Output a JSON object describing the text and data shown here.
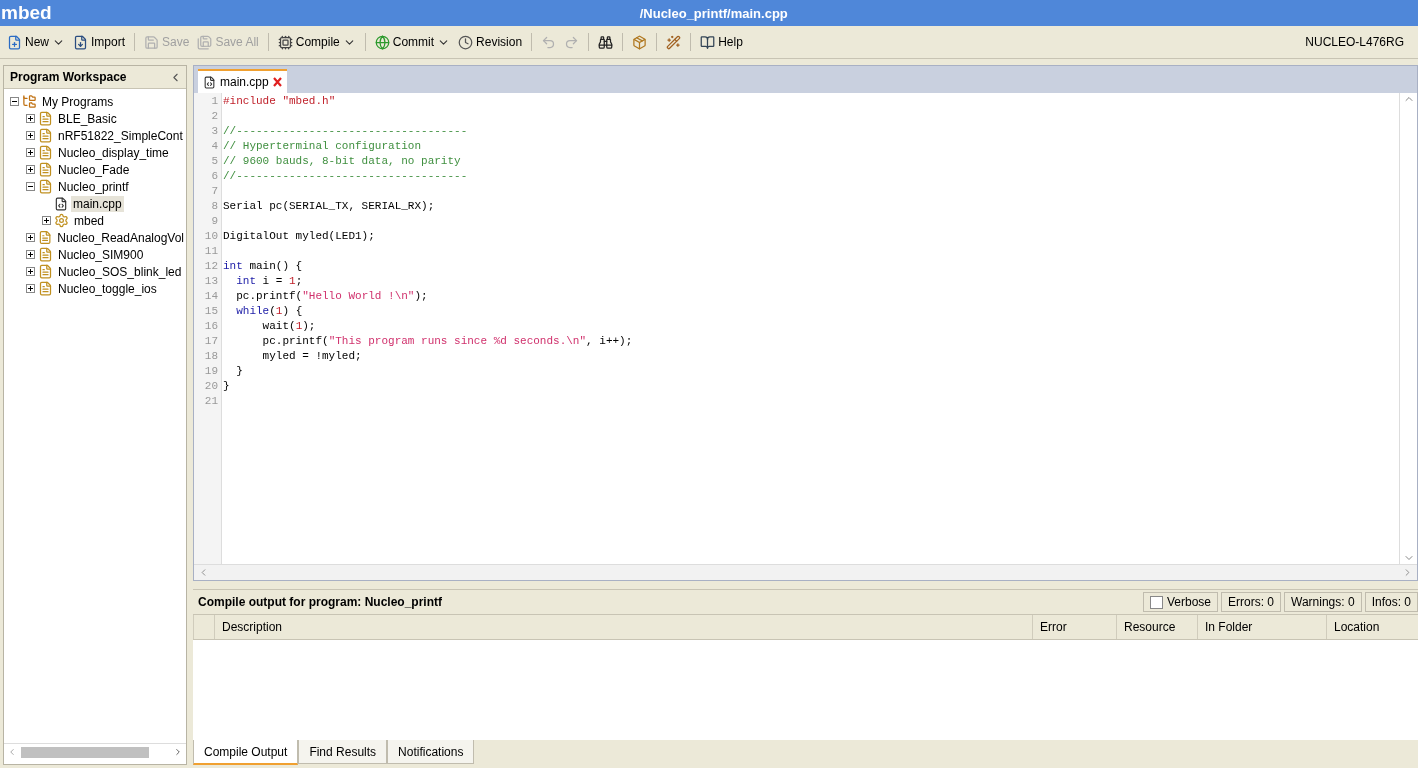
{
  "window": {
    "app": "mbed",
    "title": "/Nucleo_printf/main.cpp"
  },
  "toolbar": {
    "items": [
      {
        "kind": "button",
        "label": "New",
        "dropdown": true,
        "disabled": false
      },
      {
        "kind": "button",
        "label": "Import",
        "dropdown": false,
        "disabled": false
      },
      {
        "kind": "separator"
      },
      {
        "kind": "button",
        "label": "Save",
        "dropdown": false,
        "disabled": true
      },
      {
        "kind": "button",
        "label": "Save All",
        "dropdown": false,
        "disabled": true
      },
      {
        "kind": "separator"
      },
      {
        "kind": "button",
        "label": "Compile",
        "dropdown": true,
        "disabled": false
      },
      {
        "kind": "separator"
      },
      {
        "kind": "button",
        "label": "Commit",
        "dropdown": true,
        "disabled": false
      },
      {
        "kind": "button",
        "label": "Revision",
        "dropdown": false,
        "disabled": false
      },
      {
        "kind": "separator"
      },
      {
        "kind": "icon",
        "disabled": true
      },
      {
        "kind": "icon",
        "disabled": true
      },
      {
        "kind": "separator"
      },
      {
        "kind": "icon",
        "disabled": false
      },
      {
        "kind": "separator"
      },
      {
        "kind": "icon",
        "disabled": false
      },
      {
        "kind": "separator"
      },
      {
        "kind": "icon",
        "disabled": false
      },
      {
        "kind": "separator"
      },
      {
        "kind": "button",
        "label": "Help",
        "dropdown": false,
        "disabled": false
      }
    ],
    "platform": "NUCLEO-L476RG"
  },
  "workspace": {
    "title": "Program Workspace",
    "tree": [
      {
        "label": "My Programs",
        "kind": "root",
        "expanded": true,
        "selected": false,
        "children": [
          {
            "label": "BLE_Basic",
            "kind": "program",
            "expanded": false,
            "selected": false
          },
          {
            "label": "nRF51822_SimpleCont",
            "kind": "program",
            "expanded": false,
            "selected": false
          },
          {
            "label": "Nucleo_display_time",
            "kind": "program",
            "expanded": false,
            "selected": false
          },
          {
            "label": "Nucleo_Fade",
            "kind": "program",
            "expanded": false,
            "selected": false
          },
          {
            "label": "Nucleo_printf",
            "kind": "program",
            "expanded": true,
            "selected": false,
            "children": [
              {
                "label": "main.cpp",
                "kind": "file",
                "selected": true
              },
              {
                "label": "mbed",
                "kind": "library",
                "expanded": false,
                "selected": false
              }
            ]
          },
          {
            "label": "Nucleo_ReadAnalogVol",
            "kind": "program",
            "expanded": false,
            "selected": false
          },
          {
            "label": "Nucleo_SIM900",
            "kind": "program",
            "expanded": false,
            "selected": false
          },
          {
            "label": "Nucleo_SOS_blink_led",
            "kind": "program",
            "expanded": false,
            "selected": false
          },
          {
            "label": "Nucleo_toggle_ios",
            "kind": "program",
            "expanded": false,
            "selected": false
          }
        ]
      }
    ]
  },
  "editor": {
    "tabs": [
      {
        "label": "main.cpp",
        "selected": true
      }
    ],
    "lines": [
      {
        "n": "1",
        "tokens": [
          {
            "t": "#include ",
            "kind": "preproc"
          },
          {
            "t": "\"mbed.h\"",
            "kind": "preproc"
          }
        ]
      },
      {
        "n": "2"
      },
      {
        "n": "3",
        "tokens": [
          {
            "t": "//-----------------------------------",
            "kind": "comment"
          }
        ]
      },
      {
        "n": "4",
        "tokens": [
          {
            "t": "// Hyperterminal configuration",
            "kind": "comment"
          }
        ]
      },
      {
        "n": "5",
        "tokens": [
          {
            "t": "// 9600 bauds, 8-bit data, no parity",
            "kind": "comment"
          }
        ]
      },
      {
        "n": "6",
        "tokens": [
          {
            "t": "//-----------------------------------",
            "kind": "comment"
          }
        ]
      },
      {
        "n": "7"
      },
      {
        "n": "8",
        "tokens": [
          {
            "t": "Serial pc(SERIAL_TX, SERIAL_RX);",
            "kind": "plain"
          }
        ]
      },
      {
        "n": "9"
      },
      {
        "n": "10",
        "tokens": [
          {
            "t": "DigitalOut myled(LED1);",
            "kind": "plain"
          }
        ]
      },
      {
        "n": "11"
      },
      {
        "n": "12",
        "tokens": [
          {
            "t": "int",
            "kind": "keyword"
          },
          {
            "t": " main() {",
            "kind": "plain"
          }
        ]
      },
      {
        "n": "13",
        "tokens": [
          {
            "t": "  int",
            "kind": "keyword"
          },
          {
            "t": " i = ",
            "kind": "plain"
          },
          {
            "t": "1",
            "kind": "number"
          },
          {
            "t": ";",
            "kind": "plain"
          }
        ]
      },
      {
        "n": "14",
        "tokens": [
          {
            "t": "  pc.printf(",
            "kind": "plain"
          },
          {
            "t": "\"Hello World !\\n\"",
            "kind": "string"
          },
          {
            "t": ");",
            "kind": "plain"
          }
        ]
      },
      {
        "n": "15",
        "tokens": [
          {
            "t": "  while",
            "kind": "keyword"
          },
          {
            "t": "(",
            "kind": "plain"
          },
          {
            "t": "1",
            "kind": "number"
          },
          {
            "t": ") {",
            "kind": "plain"
          }
        ]
      },
      {
        "n": "16",
        "tokens": [
          {
            "t": "      wait(",
            "kind": "plain"
          },
          {
            "t": "1",
            "kind": "number"
          },
          {
            "t": ");",
            "kind": "plain"
          }
        ]
      },
      {
        "n": "17",
        "tokens": [
          {
            "t": "      pc.printf(",
            "kind": "plain"
          },
          {
            "t": "\"This program runs since %d seconds.\\n\"",
            "kind": "string"
          },
          {
            "t": ", i++);",
            "kind": "plain"
          }
        ]
      },
      {
        "n": "18",
        "tokens": [
          {
            "t": "      myled = !myled;",
            "kind": "plain"
          }
        ]
      },
      {
        "n": "19",
        "tokens": [
          {
            "t": "  }",
            "kind": "plain"
          }
        ]
      },
      {
        "n": "20",
        "tokens": [
          {
            "t": "}",
            "kind": "plain"
          }
        ]
      },
      {
        "n": "21"
      }
    ]
  },
  "output": {
    "title": "Compile output for program: Nucleo_printf",
    "verbose": {
      "label": "Verbose",
      "checked": false
    },
    "counters": [
      "Errors: 0",
      "Warnings: 0",
      "Infos: 0"
    ],
    "columns": [
      "Description",
      "Error",
      "Resource",
      "In Folder",
      "Location"
    ],
    "tabs": [
      {
        "label": "Compile Output",
        "selected": true
      },
      {
        "label": "Find Results",
        "selected": false
      },
      {
        "label": "Notifications",
        "selected": false
      }
    ]
  }
}
